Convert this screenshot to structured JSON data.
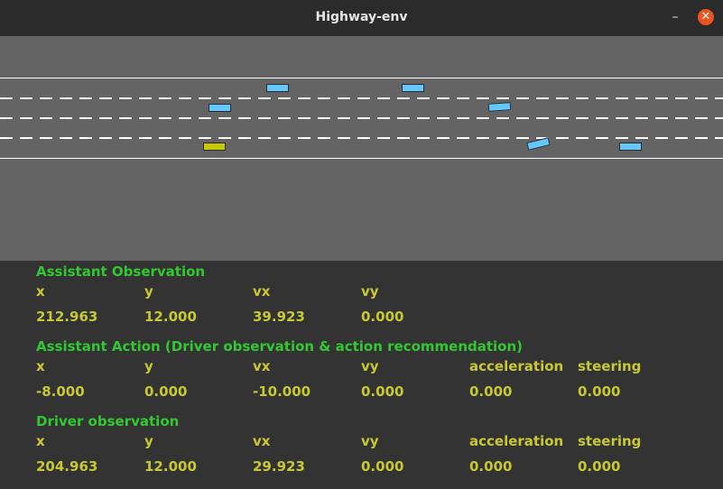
{
  "window": {
    "title": "Highway-env",
    "minimize_glyph": "–",
    "close_glyph": "✕"
  },
  "scene": {
    "colors": {
      "road": "#646464",
      "lane_marking": "#ffffff",
      "vehicle": "#64c8ff",
      "ego_vehicle": "#c8c800"
    },
    "vehicles": [
      "vehicle",
      "vehicle",
      "vehicle",
      "vehicle",
      "vehicle",
      "vehicle",
      "ego-vehicle"
    ]
  },
  "assistant_observation": {
    "heading": "Assistant Observation",
    "columns": [
      "x",
      "y",
      "vx",
      "vy"
    ],
    "values": [
      "212.963",
      "12.000",
      "39.923",
      "0.000"
    ]
  },
  "assistant_action": {
    "heading": "Assistant Action (Driver observation & action recommendation)",
    "columns": [
      "x",
      "y",
      "vx",
      "vy",
      "acceleration",
      "steering"
    ],
    "values": [
      "-8.000",
      "0.000",
      "-10.000",
      "0.000",
      "0.000",
      "0.000"
    ]
  },
  "driver_observation": {
    "heading": "Driver observation",
    "columns": [
      "x",
      "y",
      "vx",
      "vy",
      "acceleration",
      "steering"
    ],
    "values": [
      "204.963",
      "12.000",
      "29.923",
      "0.000",
      "0.000",
      "0.000"
    ]
  }
}
